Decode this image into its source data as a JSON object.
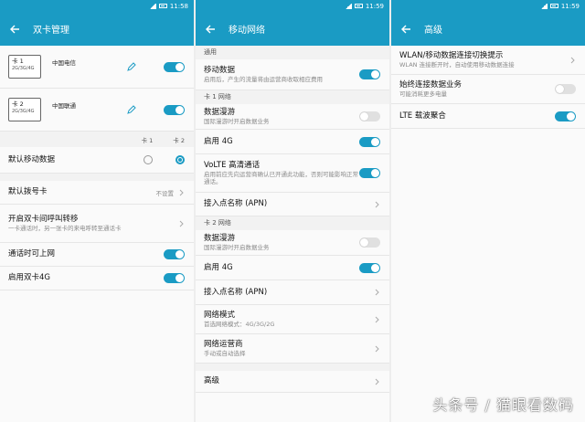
{
  "colors": {
    "accent": "#1a9bc4",
    "toggle_off": "#e0e0e0"
  },
  "panel1": {
    "status_time": "11:58",
    "title": "双卡管理",
    "sim1": {
      "name": "卡 1",
      "gen": "2G/3G/4G",
      "carrier": "中国电信"
    },
    "sim2": {
      "name": "卡 2",
      "gen": "2G/3G/4G",
      "carrier": "中国联通"
    },
    "col_card1": "卡 1",
    "col_card2": "卡 2",
    "default_data_label": "默认移动数据",
    "default_dial_label": "默认拨号卡",
    "default_dial_value": "不设置",
    "forward_title": "开启双卡间呼叫转移",
    "forward_sub": "一卡通话时，另一张卡的来电呼转至通话卡",
    "call_online_label": "通话时可上网",
    "enable_dual_label": "启用双卡4G"
  },
  "panel2": {
    "status_time": "11:59",
    "title": "移动网络",
    "section_general": "通用",
    "mobile_data_title": "移动数据",
    "mobile_data_sub": "启用后，产生的流量将由运营商收取相应费用",
    "section_card1": "卡 1 网络",
    "roaming1_title": "数据漫游",
    "roaming1_sub": "国际漫游时开启数据业务",
    "enable4g_1": "启用 4G",
    "volte_title": "VoLTE 高清通话",
    "volte_sub": "启用前应先向运营商确认已开通此功能，否则可能影响正常通话。",
    "apn1": "接入点名称 (APN)",
    "section_card2": "卡 2 网络",
    "roaming2_title": "数据漫游",
    "roaming2_sub": "国际漫游时开启数据业务",
    "enable4g_2": "启用 4G",
    "apn2": "接入点名称 (APN)",
    "network_mode_title": "网络模式",
    "network_mode_sub": "首选网络模式：4G/3G/2G",
    "operator_title": "网络运营商",
    "operator_sub": "手动或自动选择",
    "advanced": "高级"
  },
  "panel3": {
    "status_time": "11:59",
    "title": "高级",
    "wlan_title": "WLAN/移动数据连接切换提示",
    "wlan_sub": "WLAN 连接断开时，自动使用移动数据连接",
    "always_on_title": "始终连接数据业务",
    "always_on_sub": "可能消耗更多电量",
    "lte_ca": "LTE 载波聚合"
  },
  "watermark": "头条号 / 猫眼看数码"
}
